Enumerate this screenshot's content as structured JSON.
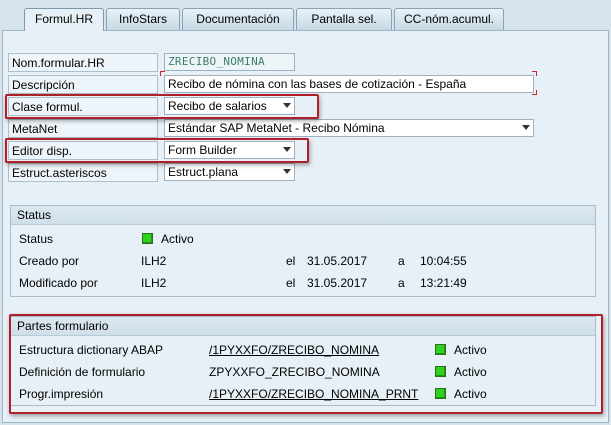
{
  "tabs": [
    {
      "label": "Formul.HR",
      "active": true
    },
    {
      "label": "InfoStars",
      "active": false
    },
    {
      "label": "Documentación",
      "active": false
    },
    {
      "label": "Pantalla sel.",
      "active": false
    },
    {
      "label": "CC-nóm.acumul.",
      "active": false
    }
  ],
  "form": {
    "nom_label": "Nom.formular.HR",
    "nom_value": "ZRECIBO_NOMINA",
    "desc_label": "Descripción",
    "desc_value": "Recibo de nómina con las bases de cotización - España",
    "clase_label": "Clase formul.",
    "clase_value": "Recibo de salarios",
    "metanet_label": "MetaNet",
    "metanet_value": "Estándar SAP MetaNet - Recibo Nómina",
    "editor_label": "Editor disp.",
    "editor_value": "Form Builder",
    "estruct_label": "Estruct.asteriscos",
    "estruct_value": "Estruct.plana"
  },
  "status": {
    "title": "Status",
    "status_label": "Status",
    "status_value": "Activo",
    "created_label": "Creado por",
    "created_user": "ILH2",
    "created_el": "el",
    "created_date": "31.05.2017",
    "created_a": "a",
    "created_time": "10:04:55",
    "modified_label": "Modificado por",
    "modified_user": "ILH2",
    "modified_el": "el",
    "modified_date": "31.05.2017",
    "modified_a": "a",
    "modified_time": "13:21:49",
    "led_color": "#2fd11f"
  },
  "parts": {
    "title": "Partes formulario",
    "rows": [
      {
        "label": "Estructura dictionary ABAP",
        "value": "/1PYXXFO/ZRECIBO_NOMINA",
        "status": "Activo"
      },
      {
        "label": "Definición de formulario",
        "value": "ZPYXXFO_ZRECIBO_NOMINA",
        "status": "Activo"
      },
      {
        "label": "Progr.impresión",
        "value": "/1PYXXFO/ZRECIBO_NOMINA_PRNT",
        "status": "Activo"
      }
    ]
  },
  "colors": {
    "highlight": "#b11f2b",
    "background": "#d5e3ec"
  }
}
